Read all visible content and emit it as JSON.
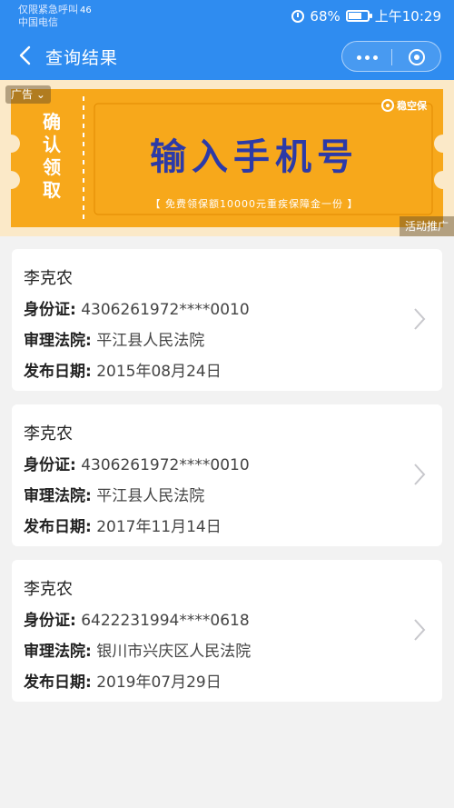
{
  "status_bar": {
    "carrier_line1": "仅限紧急呼叫",
    "carrier_line2": "中国电信",
    "signal_text": "46",
    "battery": "68%",
    "time": "上午10:29",
    "battery_level": 0.68
  },
  "nav": {
    "title": "查询结果"
  },
  "ad": {
    "tag": "广告",
    "side_text": "确认领取",
    "headline": "输入手机号",
    "subline": "【 免费领保额10000元重疾保障金一份 】",
    "brand": "稳空保",
    "promo_label": "活动推广"
  },
  "results": [
    {
      "name": "李克农",
      "id_label": "身份证:",
      "id_value": "4306261972****0010",
      "court_label": "审理法院:",
      "court_value": "平江县人民法院",
      "date_label": "发布日期:",
      "date_value": "2015年08月24日"
    },
    {
      "name": "李克农",
      "id_label": "身份证:",
      "id_value": "4306261972****0010",
      "court_label": "审理法院:",
      "court_value": "平江县人民法院",
      "date_label": "发布日期:",
      "date_value": "2017年11月14日"
    },
    {
      "name": "李克农",
      "id_label": "身份证:",
      "id_value": "6422231994****0618",
      "court_label": "审理法院:",
      "court_value": "银川市兴庆区人民法院",
      "date_label": "发布日期:",
      "date_value": "2019年07月29日"
    }
  ],
  "colors": {
    "header_blue": "#2f8cf0",
    "ad_orange": "#f7a81b",
    "ad_headline": "#2c3aa8",
    "page_bg": "#f2f2f2"
  }
}
